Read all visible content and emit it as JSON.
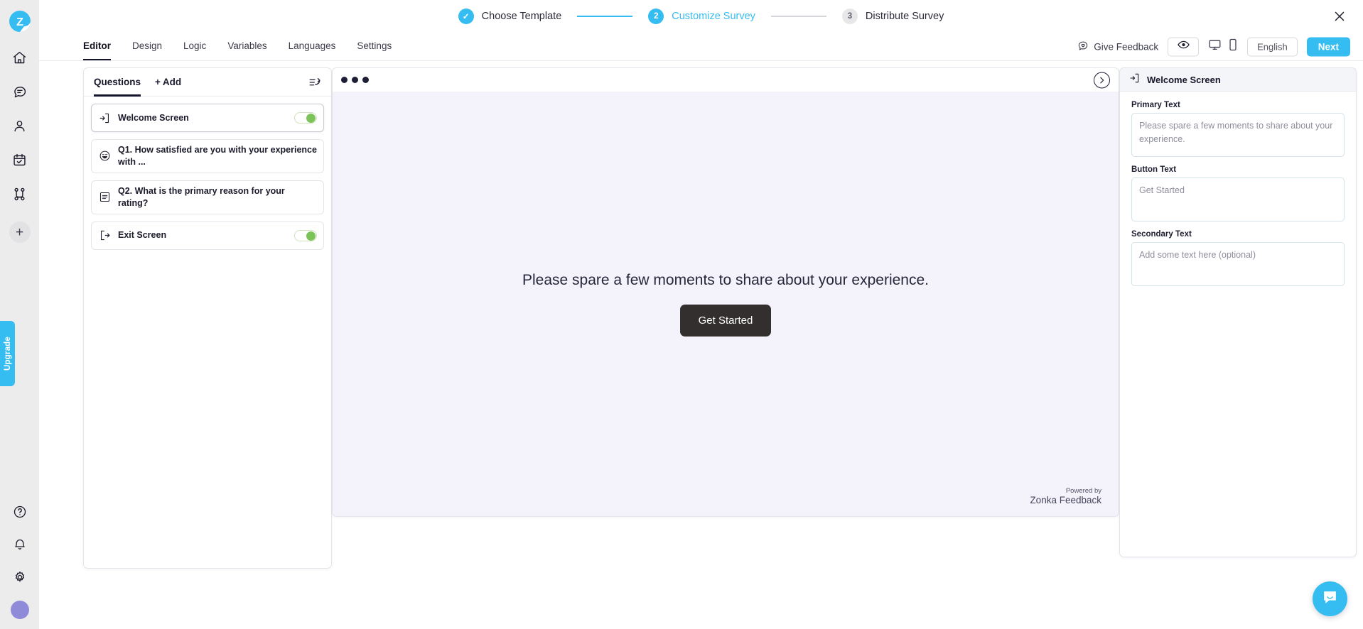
{
  "brand": {
    "accent": "#35bdf2",
    "logo_letter": "Z",
    "name": "Zonka Feedback"
  },
  "rail": {
    "logo_name": "zonka-logo",
    "items": [
      {
        "icon": "home-icon",
        "name": "home"
      },
      {
        "icon": "feedback-chat-icon",
        "name": "feedback"
      },
      {
        "icon": "person-icon",
        "name": "contacts"
      },
      {
        "icon": "calendar-check-icon",
        "name": "tasks"
      },
      {
        "icon": "workflow-icon",
        "name": "workflows"
      }
    ],
    "add_label": "+",
    "upgrade_label": "Upgrade",
    "bottom": [
      {
        "icon": "help-circle-icon",
        "name": "help"
      },
      {
        "icon": "bell-icon",
        "name": "notifications"
      },
      {
        "icon": "gear-icon",
        "name": "settings"
      }
    ]
  },
  "stepper": {
    "steps": [
      {
        "badge": "✓",
        "label": "Choose Template",
        "state": "done"
      },
      {
        "badge": "2",
        "label": "Customize Survey",
        "state": "active"
      },
      {
        "badge": "3",
        "label": "Distribute Survey",
        "state": "todo"
      }
    ],
    "close_label": "✕"
  },
  "tabbar": {
    "tabs": [
      {
        "label": "Editor",
        "active": true
      },
      {
        "label": "Design",
        "active": false
      },
      {
        "label": "Logic",
        "active": false
      },
      {
        "label": "Variables",
        "active": false
      },
      {
        "label": "Languages",
        "active": false
      },
      {
        "label": "Settings",
        "active": false
      }
    ],
    "give_feedback": "Give Feedback",
    "preview_icon": "eye-icon",
    "desktop_icon": "monitor-icon",
    "mobile_icon": "mobile-icon",
    "language": "English",
    "next": "Next"
  },
  "questions_panel": {
    "title": "Questions",
    "add_label": "Add",
    "add_plus": "+",
    "collapse_icon": "collapse-list-icon",
    "rows": [
      {
        "icon": "enter-door-icon",
        "label": "Welcome Screen",
        "toggle": true,
        "selected": true
      },
      {
        "icon": "smiley-icon",
        "label": "Q1. How satisfied are you with your experience with ...",
        "toggle": false,
        "selected": false
      },
      {
        "icon": "text-lines-icon",
        "label": "Q2. What is the primary reason for your rating?",
        "toggle": false,
        "selected": false
      },
      {
        "icon": "exit-door-icon",
        "label": "Exit Screen",
        "toggle": true,
        "selected": false
      }
    ]
  },
  "canvas": {
    "dots_count": 3,
    "next_icon": "chevron-right-icon",
    "primary_text": "Please spare a few moments to share about your experience.",
    "button_text": "Get Started",
    "powered_by_small": "Powered by",
    "powered_by_big": "Zonka Feedback",
    "background": "#f4f3fc",
    "button_color": "#332f2f"
  },
  "right_panel": {
    "header_icon": "enter-door-icon",
    "header_title": "Welcome Screen",
    "fields": [
      {
        "label": "Primary Text",
        "value": "Please spare a few moments to share about your experience.",
        "placeholder": "Please spare a few moments to share about your experience."
      },
      {
        "label": "Button Text",
        "value": "Get Started",
        "placeholder": "Get Started"
      },
      {
        "label": "Secondary Text",
        "value": "Add some text here (optional)",
        "placeholder": "Add some text here (optional)"
      }
    ]
  },
  "chat": {
    "icon": "chat-bubble-icon"
  }
}
